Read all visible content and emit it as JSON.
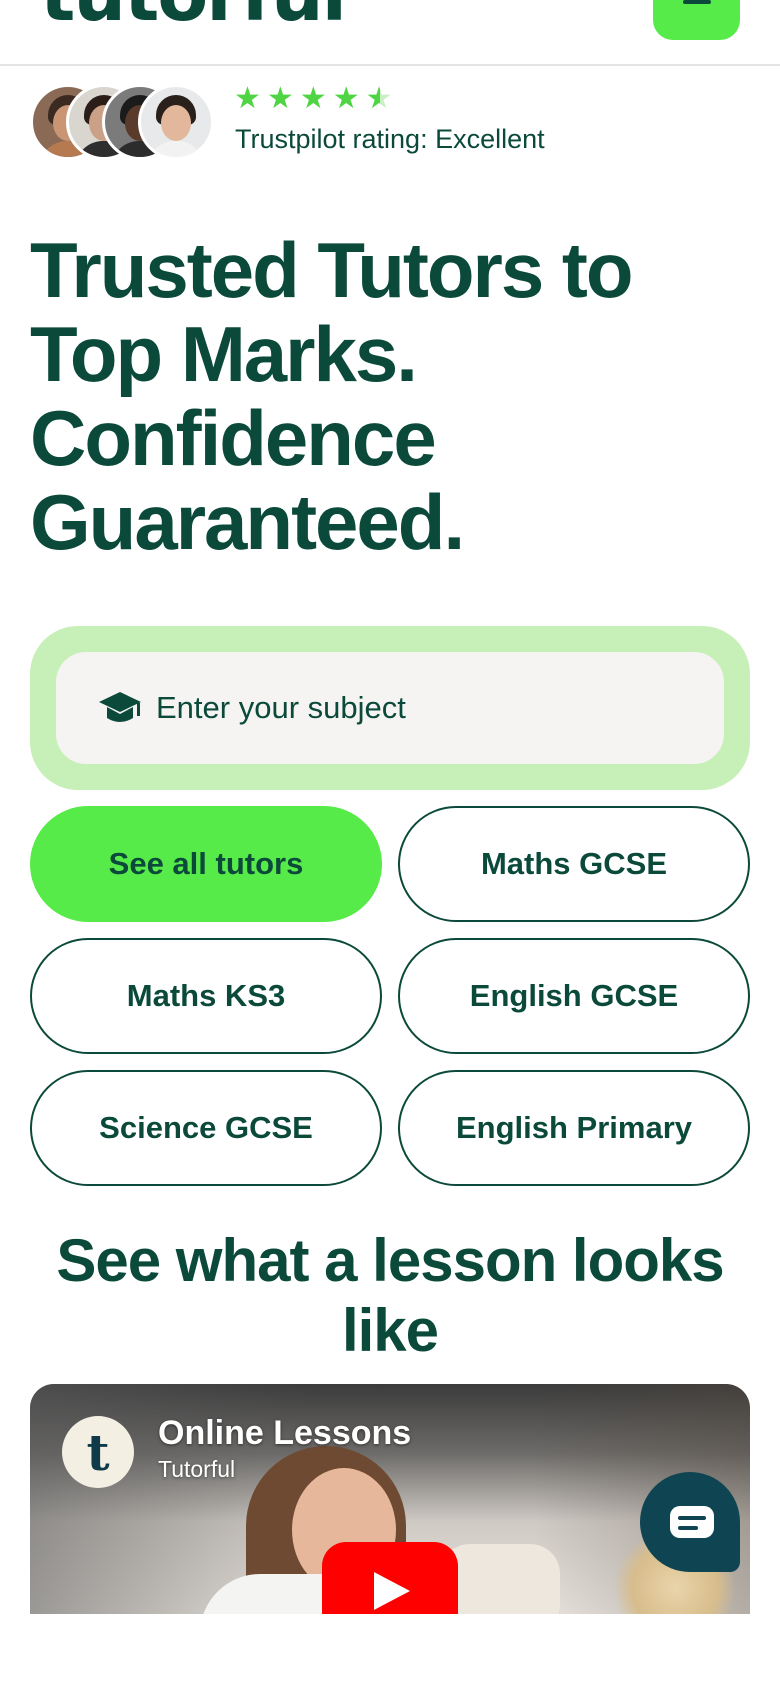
{
  "header": {
    "logo_text": "tutorful",
    "menu_icon": "hamburger-menu-icon"
  },
  "rating": {
    "stars": 4.5,
    "stars_max": 5,
    "text": "Trustpilot rating: Excellent",
    "star_color": "#4fd444"
  },
  "hero": {
    "line1": "Trusted Tutors to",
    "line2": "Top Marks.",
    "line3": "Confidence",
    "line4": "Guaranteed."
  },
  "search": {
    "placeholder": "Enter your subject",
    "icon": "graduation-cap-icon"
  },
  "chips": [
    {
      "label": "See all tutors",
      "primary": true
    },
    {
      "label": "Maths GCSE"
    },
    {
      "label": "Maths KS3"
    },
    {
      "label": "English GCSE"
    },
    {
      "label": "Science GCSE"
    },
    {
      "label": "English Primary"
    }
  ],
  "lesson": {
    "title": "See what a lesson looks like"
  },
  "video": {
    "channel_letter": "t",
    "title": "Online Lessons",
    "channel": "Tutorful",
    "play_icon": "play-icon"
  },
  "chat": {
    "icon": "chat-bubble-icon"
  },
  "colors": {
    "brand_dark": "#0b4a3a",
    "brand_green": "#57eb49",
    "search_outer": "#c7f0b8",
    "youtube_red": "#ff0000",
    "chat_bg": "#0f4452"
  }
}
